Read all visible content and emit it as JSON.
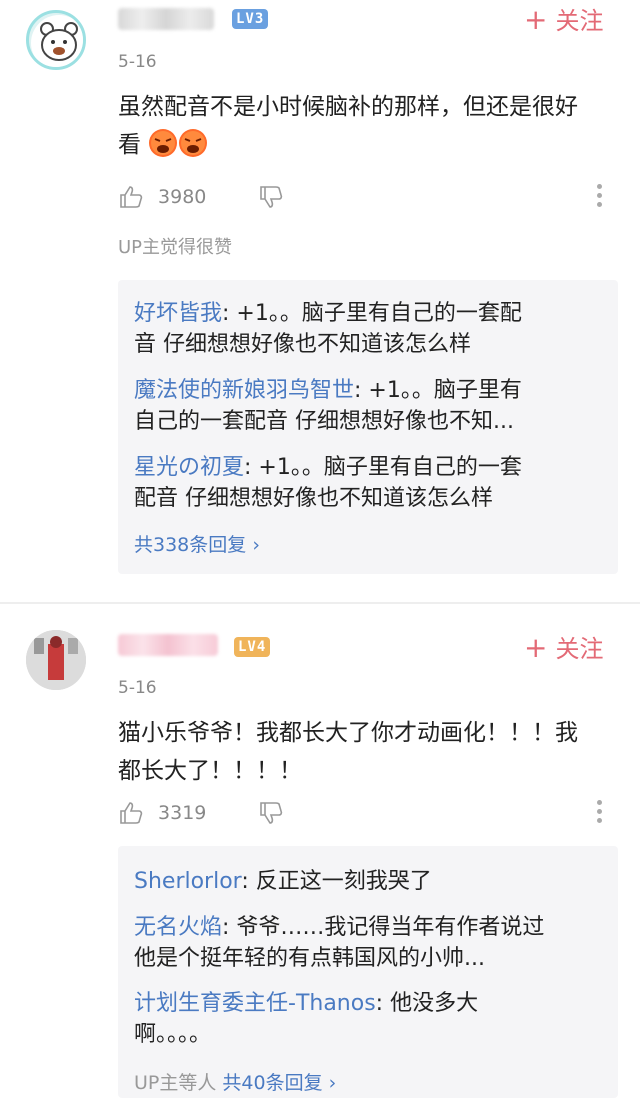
{
  "comments": [
    {
      "level": "LV3",
      "level_color": "#6aa0e0",
      "follow_label": "关注",
      "date": "5-16",
      "text_line1": "虽然配音不是小时候脑补的那样，但还是很好",
      "text_line2": "看",
      "emoji": [
        "angry-face-emoji",
        "angry-face-emoji"
      ],
      "likes": "3980",
      "up_note": "UP主觉得很赞",
      "replies": [
        {
          "name": "好坏皆我",
          "line1_rest": ": +1。。脑子里有自己的一套配",
          "line2": "音 仔细想想好像也不知道该怎么样"
        },
        {
          "name": "魔法使的新娘羽鸟智世",
          "line1_rest": ": +1。。脑子里有",
          "line2": "自己的一套配音 仔细想想好像也不知..."
        },
        {
          "name": "星光の初夏",
          "line1_rest": ": +1。。脑子里有自己的一套",
          "line2": "配音 仔细想想好像也不知道该怎么样"
        }
      ],
      "more_prefix": "",
      "more_label": "共338条回复"
    },
    {
      "level": "LV4",
      "level_color": "#f0b45a",
      "follow_label": "关注",
      "date": "5-16",
      "text_line1": "猫小乐爷爷！我都长大了你才动画化！！！我",
      "text_line2": "都长大了！！！！",
      "likes": "3319",
      "replies": [
        {
          "name": "Sherlorlor",
          "line1_rest": ": 反正这一刻我哭了",
          "line2": ""
        },
        {
          "name": "无名火焰",
          "line1_rest": ": 爷爷……我记得当年有作者说过",
          "line2": "他是个挺年轻的有点韩国风的小帅..."
        },
        {
          "name": "计划生育委主任-Thanos",
          "line1_rest": ": 他没多大",
          "line2": "啊。。。。"
        }
      ],
      "more_prefix": "UP主等人 ",
      "more_label": "共40条回复"
    }
  ],
  "colors": {
    "accent": "#e36a76",
    "link": "#4a7ac2",
    "reply_bg": "#f5f5f7"
  }
}
